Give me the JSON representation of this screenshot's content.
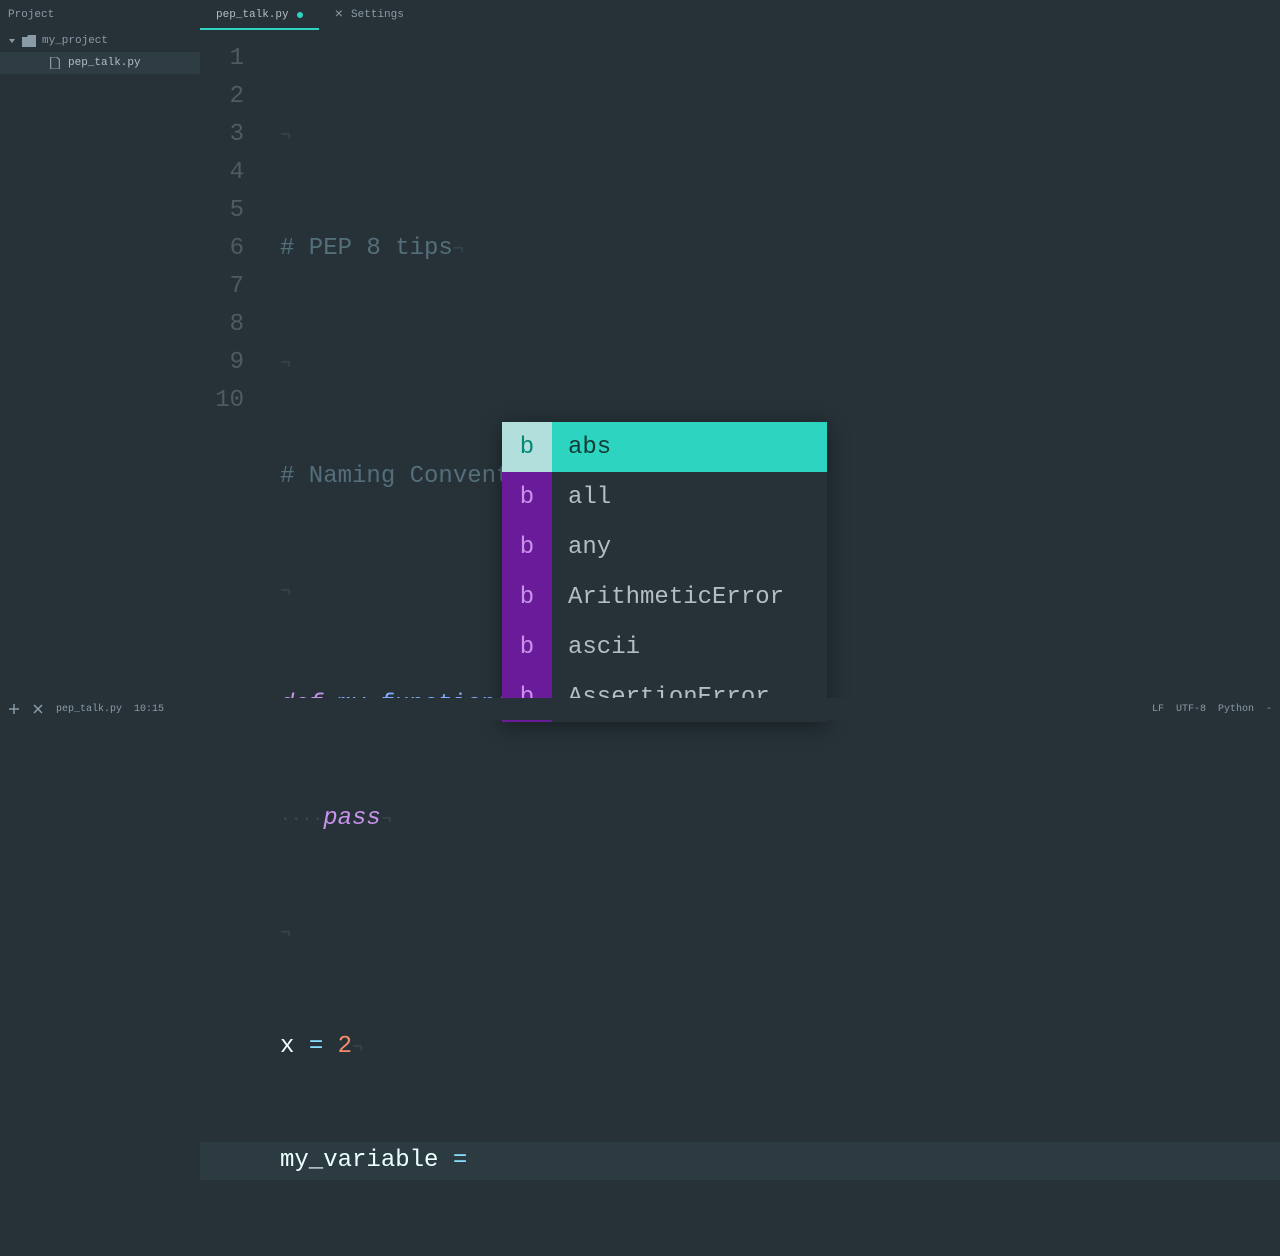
{
  "project_label": "Project",
  "tabs": [
    {
      "label": "pep_talk.py",
      "modified": true
    },
    {
      "label": "Settings"
    }
  ],
  "tree": {
    "folder": "my_project",
    "file": "pep_talk.py"
  },
  "gutter": [
    "1",
    "2",
    "3",
    "4",
    "5",
    "6",
    "7",
    "8",
    "9",
    "10"
  ],
  "code": {
    "l2": "# PEP 8 tips",
    "l4": "# Naming Conventions",
    "l6_def": "def",
    "l6_name": "my_function",
    "l7_pass": "pass",
    "l9_x": "x",
    "l9_eq": "=",
    "l9_val": "2",
    "l10_var": "my_variable",
    "l10_eq": "="
  },
  "autocomplete": {
    "badge": "b",
    "items": [
      "abs",
      "all",
      "any",
      "ArithmeticError",
      "ascii",
      "AssertionError"
    ],
    "selected_index": 0
  },
  "status": {
    "file": "pep_talk.py",
    "cursor": "10:15",
    "line_ending": "LF",
    "encoding": "UTF-8",
    "language": "Python",
    "branch": "-"
  }
}
